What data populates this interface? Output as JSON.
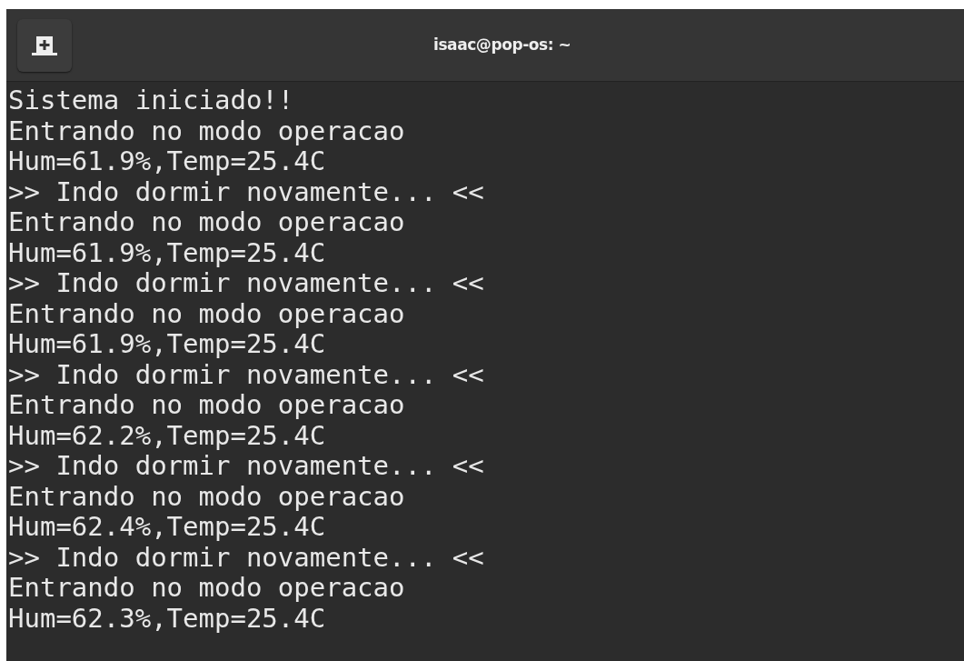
{
  "window": {
    "title": "isaac@pop-os: ~"
  },
  "terminal": {
    "lines": [
      "Sistema iniciado!!",
      "Entrando no modo operacao",
      "Hum=61.9%,Temp=25.4C",
      ">> Indo dormir novamente... <<",
      "Entrando no modo operacao",
      "Hum=61.9%,Temp=25.4C",
      ">> Indo dormir novamente... <<",
      "Entrando no modo operacao",
      "Hum=61.9%,Temp=25.4C",
      ">> Indo dormir novamente... <<",
      "Entrando no modo operacao",
      "Hum=62.2%,Temp=25.4C",
      ">> Indo dormir novamente... <<",
      "Entrando no modo operacao",
      "Hum=62.4%,Temp=25.4C",
      ">> Indo dormir novamente... <<",
      "Entrando no modo operacao",
      "Hum=62.3%,Temp=25.4C"
    ]
  }
}
